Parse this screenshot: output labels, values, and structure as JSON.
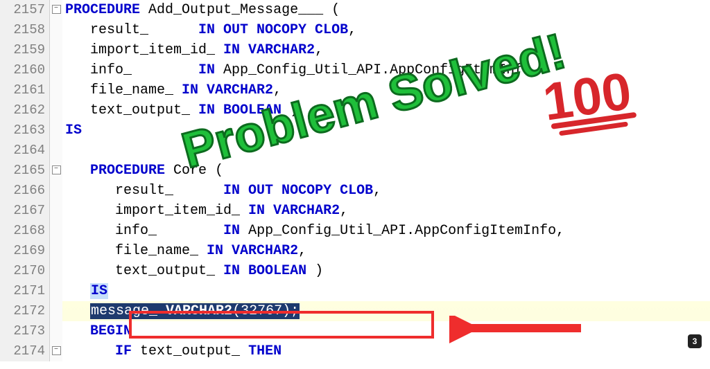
{
  "overlay_text": "Problem Solved!",
  "hundred_text": "100",
  "badge": "3",
  "lines": [
    {
      "num": "2157",
      "fold": "-",
      "tokens": [
        {
          "t": "kw",
          "v": "PROCEDURE"
        },
        {
          "t": "",
          "v": " Add_Output_Message___ ("
        }
      ]
    },
    {
      "num": "2158",
      "fold": "",
      "tokens": [
        {
          "t": "",
          "v": "   result_      "
        },
        {
          "t": "kw",
          "v": "IN OUT NOCOPY CLOB"
        },
        {
          "t": "",
          "v": ","
        }
      ]
    },
    {
      "num": "2159",
      "fold": "",
      "tokens": [
        {
          "t": "",
          "v": "   import_item_id_ "
        },
        {
          "t": "kw",
          "v": "IN VARCHAR2"
        },
        {
          "t": "",
          "v": ","
        }
      ]
    },
    {
      "num": "2160",
      "fold": "",
      "tokens": [
        {
          "t": "",
          "v": "   info_        "
        },
        {
          "t": "kw",
          "v": "IN"
        },
        {
          "t": "",
          "v": " App_Config_Util_API.AppConfigItemInfo,"
        }
      ]
    },
    {
      "num": "2161",
      "fold": "",
      "tokens": [
        {
          "t": "",
          "v": "   file_name_ "
        },
        {
          "t": "kw",
          "v": "IN VARCHAR2"
        },
        {
          "t": "",
          "v": ","
        }
      ]
    },
    {
      "num": "2162",
      "fold": "",
      "tokens": [
        {
          "t": "",
          "v": "   text_output_ "
        },
        {
          "t": "kw",
          "v": "IN BOOLEAN"
        },
        {
          "t": "",
          "v": " )"
        }
      ]
    },
    {
      "num": "2163",
      "fold": "",
      "tokens": [
        {
          "t": "kw",
          "v": "IS"
        }
      ]
    },
    {
      "num": "2164",
      "fold": "",
      "tokens": []
    },
    {
      "num": "2165",
      "fold": "-",
      "tokens": [
        {
          "t": "",
          "v": "   "
        },
        {
          "t": "kw",
          "v": "PROCEDURE"
        },
        {
          "t": "",
          "v": " Core ("
        }
      ]
    },
    {
      "num": "2166",
      "fold": "",
      "tokens": [
        {
          "t": "",
          "v": "      result_      "
        },
        {
          "t": "kw",
          "v": "IN OUT NOCOPY CLOB"
        },
        {
          "t": "",
          "v": ","
        }
      ]
    },
    {
      "num": "2167",
      "fold": "",
      "tokens": [
        {
          "t": "",
          "v": "      import_item_id_ "
        },
        {
          "t": "kw",
          "v": "IN VARCHAR2"
        },
        {
          "t": "",
          "v": ","
        }
      ]
    },
    {
      "num": "2168",
      "fold": "",
      "tokens": [
        {
          "t": "",
          "v": "      info_        "
        },
        {
          "t": "kw",
          "v": "IN"
        },
        {
          "t": "",
          "v": " App_Config_Util_API.AppConfigItemInfo,"
        }
      ]
    },
    {
      "num": "2169",
      "fold": "",
      "tokens": [
        {
          "t": "",
          "v": "      file_name_ "
        },
        {
          "t": "kw",
          "v": "IN VARCHAR2"
        },
        {
          "t": "",
          "v": ","
        }
      ]
    },
    {
      "num": "2170",
      "fold": "",
      "tokens": [
        {
          "t": "",
          "v": "      text_output_ "
        },
        {
          "t": "kw",
          "v": "IN BOOLEAN"
        },
        {
          "t": "",
          "v": " )"
        }
      ]
    },
    {
      "num": "2171",
      "fold": "",
      "tokens": [
        {
          "t": "",
          "v": "   "
        },
        {
          "t": "ishl",
          "v": "IS"
        }
      ]
    },
    {
      "num": "2172",
      "fold": "",
      "hl": true,
      "tokens": [
        {
          "t": "",
          "v": "   "
        },
        {
          "t": "sel",
          "v": "message_ VARCHAR2(32767);"
        }
      ]
    },
    {
      "num": "2173",
      "fold": "",
      "tokens": [
        {
          "t": "",
          "v": "   "
        },
        {
          "t": "kw",
          "v": "BEGIN"
        }
      ]
    },
    {
      "num": "2174",
      "fold": "-",
      "tokens": [
        {
          "t": "",
          "v": "      "
        },
        {
          "t": "kw",
          "v": "IF"
        },
        {
          "t": "",
          "v": " text_output_ "
        },
        {
          "t": "kw",
          "v": "THEN"
        }
      ]
    }
  ]
}
